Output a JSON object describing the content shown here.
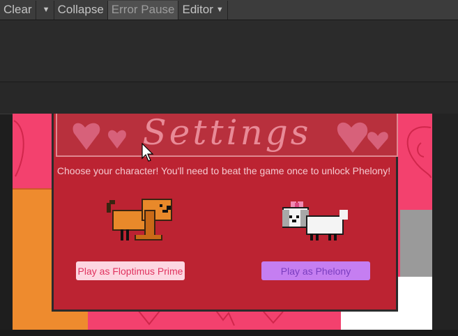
{
  "console": {
    "toolbar": {
      "clear_label": "Clear",
      "collapse_label": "Collapse",
      "error_pause_label": "Error Pause",
      "editor_label": "Editor"
    }
  },
  "game": {
    "settings_title": "Settings",
    "instructions": "Choose your character! You'll need to beat the game once to unlock Phelony!",
    "characters": [
      {
        "button_label": "Play as Floptimus Prime",
        "sprite": "orange-dog-sprite"
      },
      {
        "button_label": "Play as Phelony",
        "sprite": "white-dog-with-bow-sprite"
      }
    ],
    "colors": {
      "panel": "#bc2332",
      "floptimus_button": "#fdd6e1",
      "phelony_button": "#c57ef1"
    }
  }
}
